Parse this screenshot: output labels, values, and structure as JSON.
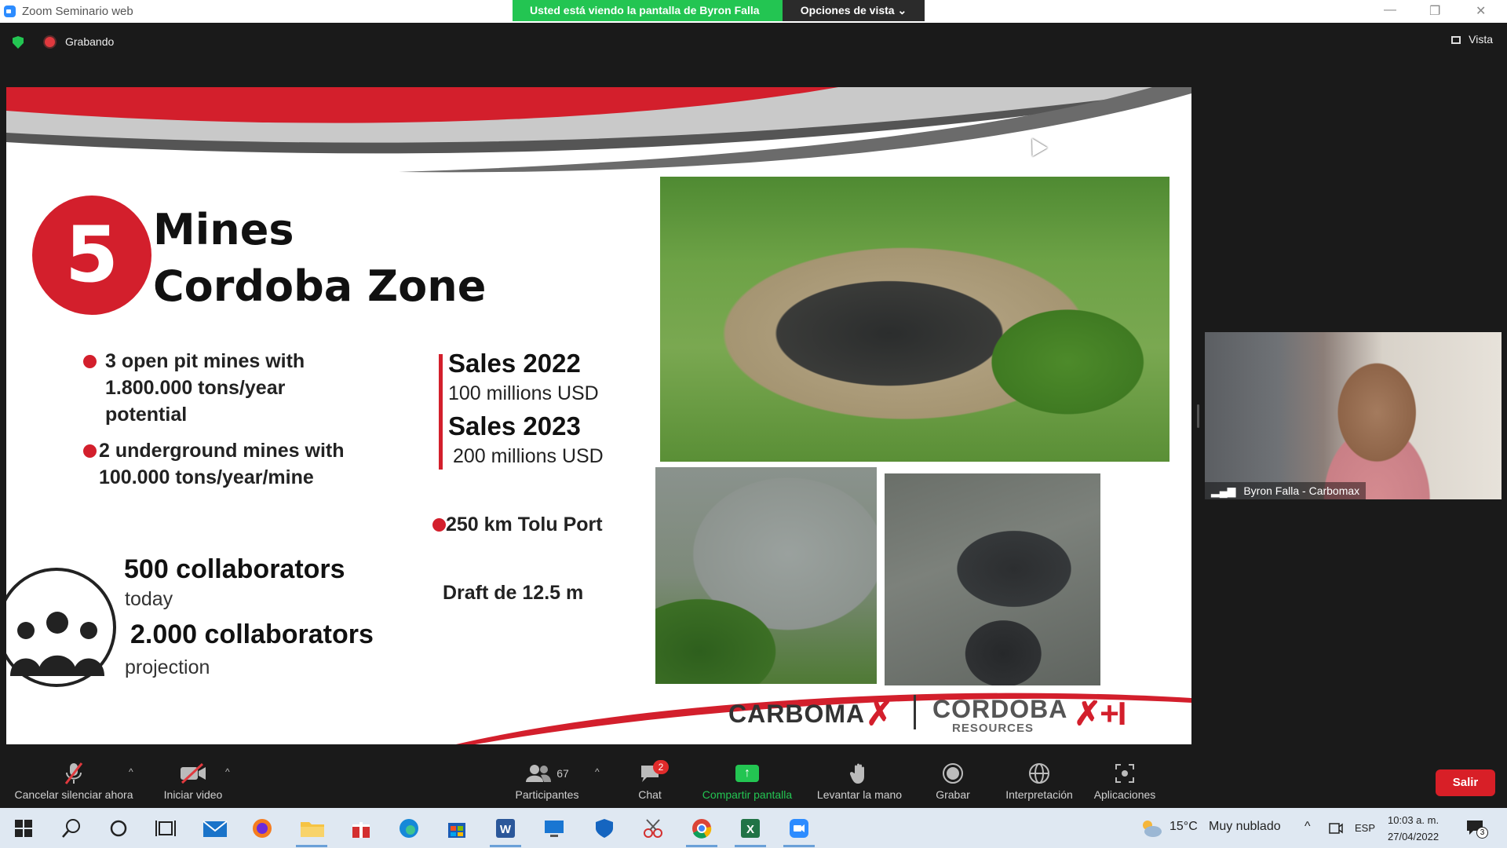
{
  "window": {
    "title": "Zoom Seminario web",
    "minimize_glyph": "—",
    "restore_glyph": "❐",
    "close_glyph": "✕"
  },
  "share_banner": {
    "viewing_text": "Usted está viendo la pantalla de Byron Falla - Carbomax",
    "options_label": "Opciones de vista",
    "options_chevron": "⌄"
  },
  "recording": {
    "label": "Grabando"
  },
  "view_button": {
    "label": "Vista"
  },
  "slide": {
    "number": "5",
    "title_line1": "Mines",
    "title_line2": "Cordoba Zone",
    "bullets": [
      {
        "line1": "3 open pit mines with",
        "line2": "1.800.000 tons/year",
        "line3": "potential"
      },
      {
        "line1": "2 underground mines with",
        "line2": "100.000 tons/year/mine"
      }
    ],
    "sales": [
      {
        "heading": "Sales 2022",
        "sub": "100 millions USD"
      },
      {
        "heading": "Sales 2023",
        "sub": "200 millions USD"
      }
    ],
    "port": "250 km Tolu Port",
    "draft": "Draft de 12.5 m",
    "collaborators_today": "500 collaborators",
    "today_label": "today",
    "collaborators_projection": "2.000 collaborators",
    "projection_label": "projection",
    "logo_carbomax": "CARBOMA",
    "logo_carbomax_x": "✗",
    "logo_cordoba": "CORDOBA",
    "logo_resources": "RESOURCES",
    "logo_cordoba_mark": "✗+I"
  },
  "video": {
    "participant_name": "Byron Falla - Carbomax",
    "signal_glyph": "▂▄▆"
  },
  "toolbar": {
    "mute_label": "Cancelar silenciar ahora",
    "video_label": "Iniciar video",
    "participants_label": "Participantes",
    "participants_count": "67",
    "chat_label": "Chat",
    "chat_badge": "2",
    "share_label": "Compartir pantalla",
    "raise_hand_label": "Levantar la mano",
    "record_label": "Grabar",
    "interpretation_label": "Interpretación",
    "apps_label": "Aplicaciones",
    "leave_label": "Salir",
    "caret_glyph": "^"
  },
  "taskbar": {
    "weather_temp": "15°C",
    "weather_desc": "Muy nublado",
    "lang": "ESP",
    "time": "10:03 a. m.",
    "date": "27/04/2022",
    "notif_count": "3",
    "tray_up": "^"
  },
  "colors": {
    "zoom_green": "#23c552",
    "carbomax_red": "#d31f2c",
    "leave_red": "#d81f27"
  }
}
